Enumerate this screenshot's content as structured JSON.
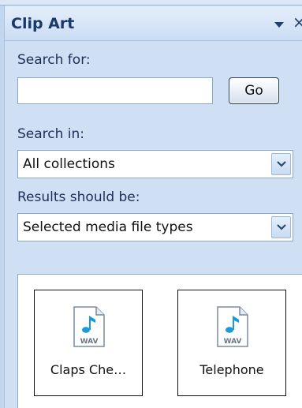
{
  "pane": {
    "title": "Clip Art"
  },
  "search": {
    "label": "Search for:",
    "value": "",
    "go_label": "Go"
  },
  "search_in": {
    "label": "Search in:",
    "selected": "All collections"
  },
  "results_type": {
    "label": "Results should be:",
    "selected": "Selected media file types"
  },
  "results": {
    "items": [
      {
        "label": "Claps Che…",
        "badge": "WAV"
      },
      {
        "label": "Telephone",
        "badge": "WAV"
      }
    ]
  }
}
